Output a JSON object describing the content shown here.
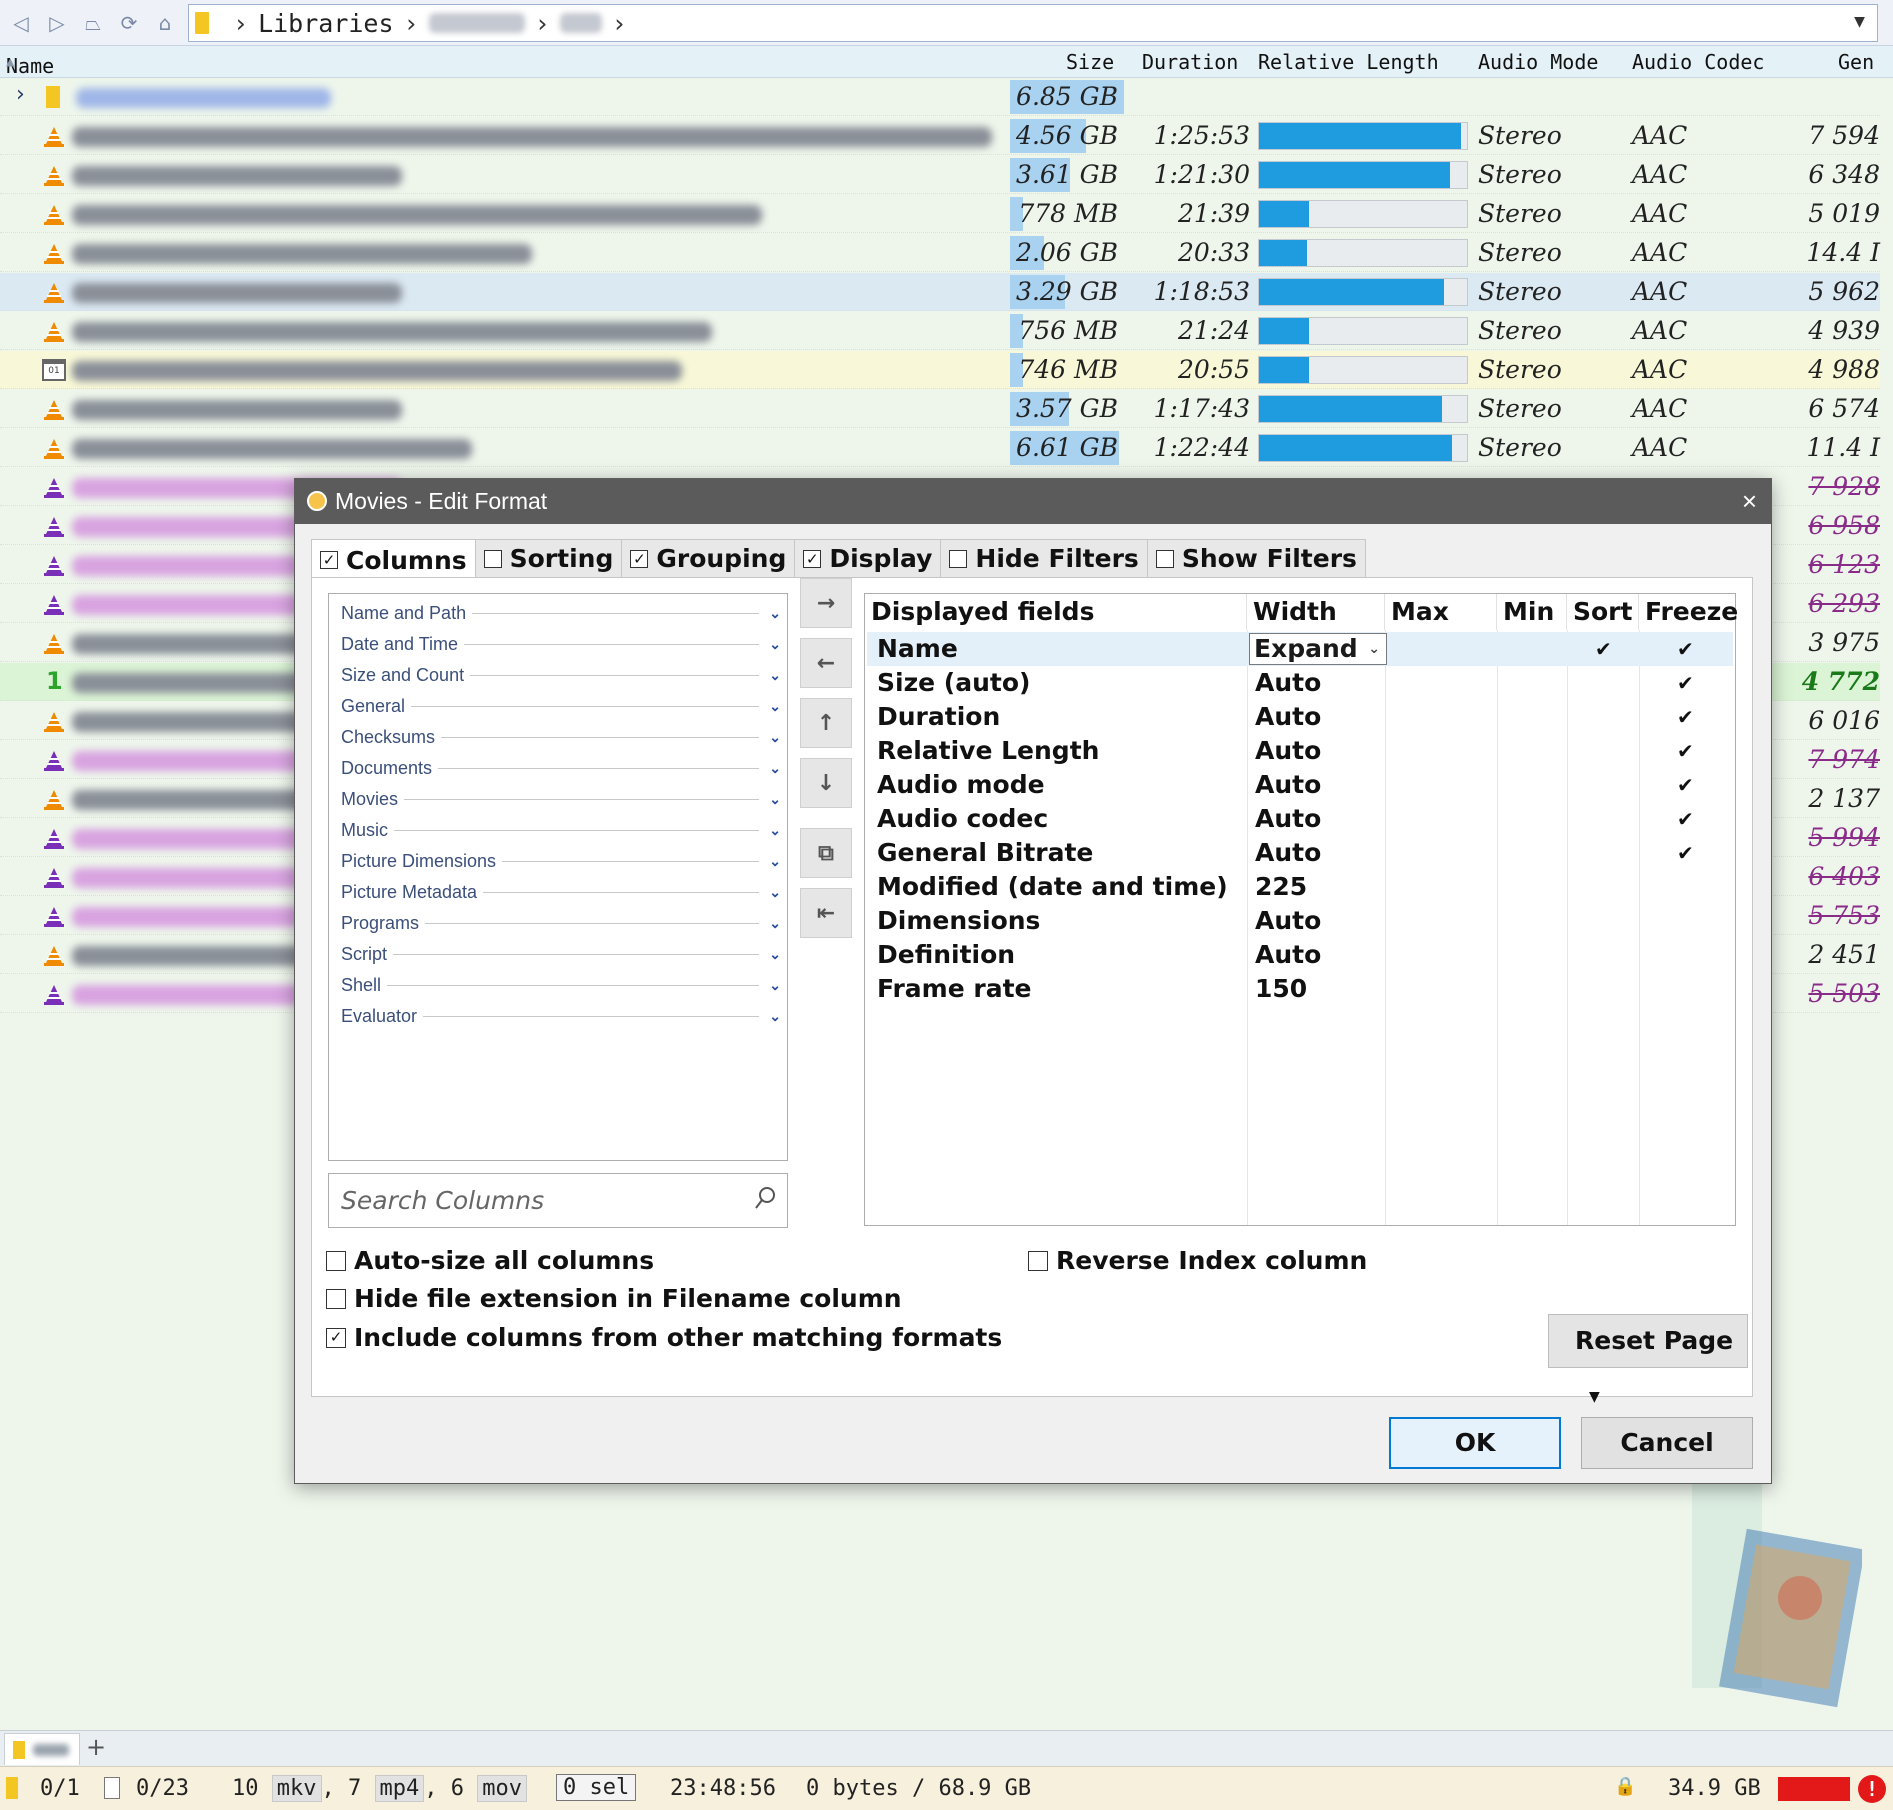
{
  "toolbar": {
    "buttons": [
      "back-icon",
      "forward-icon",
      "up-icon",
      "refresh-icon",
      "home-icon"
    ],
    "breadcrumb": [
      "Libraries"
    ]
  },
  "list": {
    "columns": {
      "name": "Name",
      "size": "Size",
      "duration": "Duration",
      "relative_length": "Relative Length",
      "audio_mode": "Audio Mode",
      "audio_codec": "Audio Codec",
      "general": "Gen"
    },
    "rows": [
      {
        "type": "folder",
        "size": "6.85 GB",
        "size_fill": 1.0
      },
      {
        "type": "vlc",
        "size": "4.56 GB",
        "size_fill": 0.67,
        "duration": "1:25:53",
        "rel": 0.97,
        "mode": "Stereo",
        "codec": "AAC",
        "gen": "7 594"
      },
      {
        "type": "vlc",
        "size": "3.61 GB",
        "size_fill": 0.53,
        "duration": "1:21:30",
        "rel": 0.92,
        "mode": "Stereo",
        "codec": "AAC",
        "gen": "6 348"
      },
      {
        "type": "vlc",
        "size": "778 MB",
        "size_fill": 0.11,
        "duration": "21:39",
        "rel": 0.24,
        "mode": "Stereo",
        "codec": "AAC",
        "gen": "5 019"
      },
      {
        "type": "vlc",
        "size": "2.06 GB",
        "size_fill": 0.3,
        "duration": "20:33",
        "rel": 0.23,
        "mode": "Stereo",
        "codec": "AAC",
        "gen": "14.4 I"
      },
      {
        "type": "vlc",
        "size": "3.29 GB",
        "size_fill": 0.48,
        "duration": "1:18:53",
        "rel": 0.89,
        "mode": "Stereo",
        "codec": "AAC",
        "gen": "5 962",
        "selected": true
      },
      {
        "type": "vlc",
        "size": "756 MB",
        "size_fill": 0.11,
        "duration": "21:24",
        "rel": 0.24,
        "mode": "Stereo",
        "codec": "AAC",
        "gen": "4 939"
      },
      {
        "type": "calendar",
        "size": "746 MB",
        "size_fill": 0.11,
        "duration": "20:55",
        "rel": 0.24,
        "mode": "Stereo",
        "codec": "AAC",
        "gen": "4 988",
        "highlight": true
      },
      {
        "type": "vlc",
        "size": "3.57 GB",
        "size_fill": 0.52,
        "duration": "1:17:43",
        "rel": 0.88,
        "mode": "Stereo",
        "codec": "AAC",
        "gen": "6 574"
      },
      {
        "type": "vlc",
        "size": "6.61 GB",
        "size_fill": 0.96,
        "duration": "1:22:44",
        "rel": 0.93,
        "mode": "Stereo",
        "codec": "AAC",
        "gen": "11.4 I"
      },
      {
        "type": "vlc-purple",
        "gen": "7 928",
        "struck": true
      },
      {
        "type": "vlc-purple",
        "gen": "6 958",
        "struck": true
      },
      {
        "type": "vlc-purple",
        "gen": "6 123",
        "struck": true
      },
      {
        "type": "vlc-purple",
        "gen": "6 293",
        "struck": true
      },
      {
        "type": "vlc",
        "gen": "3 975"
      },
      {
        "type": "number",
        "num": "1",
        "gen": "4 772",
        "green": true
      },
      {
        "type": "vlc",
        "gen": "6 016"
      },
      {
        "type": "vlc-purple",
        "gen": "7 974",
        "struck": true
      },
      {
        "type": "vlc",
        "gen": "2 137"
      },
      {
        "type": "vlc-purple",
        "gen": "5 994",
        "struck": true
      },
      {
        "type": "vlc-purple",
        "gen": "6 403",
        "struck": true
      },
      {
        "type": "vlc-purple",
        "gen": "5 753",
        "struck": true
      },
      {
        "type": "vlc",
        "gen": "2 451"
      },
      {
        "type": "vlc-purple",
        "gen": "5 503",
        "struck": true
      }
    ]
  },
  "dialog": {
    "title": "Movies - Edit Format",
    "tabs": [
      {
        "label": "Columns",
        "checked": true,
        "active": true
      },
      {
        "label": "Sorting",
        "checked": false
      },
      {
        "label": "Grouping",
        "checked": true
      },
      {
        "label": "Display",
        "checked": true
      },
      {
        "label": "Hide Filters",
        "checked": false
      },
      {
        "label": "Show Filters",
        "checked": false
      }
    ],
    "categories": [
      "Name and Path",
      "Date and Time",
      "Size and Count",
      "General",
      "Checksums",
      "Documents",
      "Movies",
      "Music",
      "Picture Dimensions",
      "Picture Metadata",
      "Programs",
      "Script",
      "Shell",
      "Evaluator"
    ],
    "search_placeholder": "Search Columns",
    "move_buttons": [
      "add-right-icon",
      "remove-left-icon",
      "move-up-icon",
      "move-down-icon",
      "collapse-icon",
      "expand-left-icon"
    ],
    "fields_header": {
      "displayed": "Displayed fields",
      "width": "Width",
      "max": "Max",
      "min": "Min",
      "sort": "Sort",
      "freeze": "Freeze"
    },
    "fields": [
      {
        "name": "Name",
        "width": "Expand",
        "sort": true,
        "freeze": true
      },
      {
        "name": "Size (auto)",
        "width": "Auto",
        "freeze": true
      },
      {
        "name": "Duration",
        "width": "Auto",
        "freeze": true
      },
      {
        "name": "Relative Length",
        "width": "Auto",
        "freeze": true
      },
      {
        "name": "Audio mode",
        "width": "Auto",
        "freeze": true
      },
      {
        "name": "Audio codec",
        "width": "Auto",
        "freeze": true
      },
      {
        "name": "General Bitrate",
        "width": "Auto",
        "freeze": true
      },
      {
        "name": "Modified (date and time)",
        "width": "225"
      },
      {
        "name": "Dimensions",
        "width": "Auto"
      },
      {
        "name": "Definition",
        "width": "Auto"
      },
      {
        "name": "Frame rate",
        "width": "150"
      }
    ],
    "options": {
      "auto_size": "Auto-size all columns",
      "hide_ext": "Hide file extension in Filename column",
      "include_cols": "Include columns from other matching formats",
      "reverse_index": "Reverse Index column"
    },
    "options_checked": {
      "auto_size": false,
      "hide_ext": false,
      "include_cols": true,
      "reverse_index": false
    },
    "reset_label": "Reset Page",
    "ok_label": "OK",
    "cancel_label": "Cancel"
  },
  "statusbar": {
    "folders": "0/1",
    "files": "0/23",
    "mkv_count": "10",
    "mkv": "mkv",
    "mp4_count": "7",
    "mp4": "mp4",
    "mov_count": "6",
    "mov": "mov",
    "sel": "0 sel",
    "duration": "23:48:56",
    "bytes": "0 bytes / 68.9 GB",
    "free": "34.9 GB"
  },
  "colors": {
    "accent_bar": "#1f9bdf",
    "size_bar": "#a8d2f0",
    "vlc_orange": "#f08a00",
    "vlc_purple": "#7a2fb8",
    "disk_red": "#e31818"
  }
}
